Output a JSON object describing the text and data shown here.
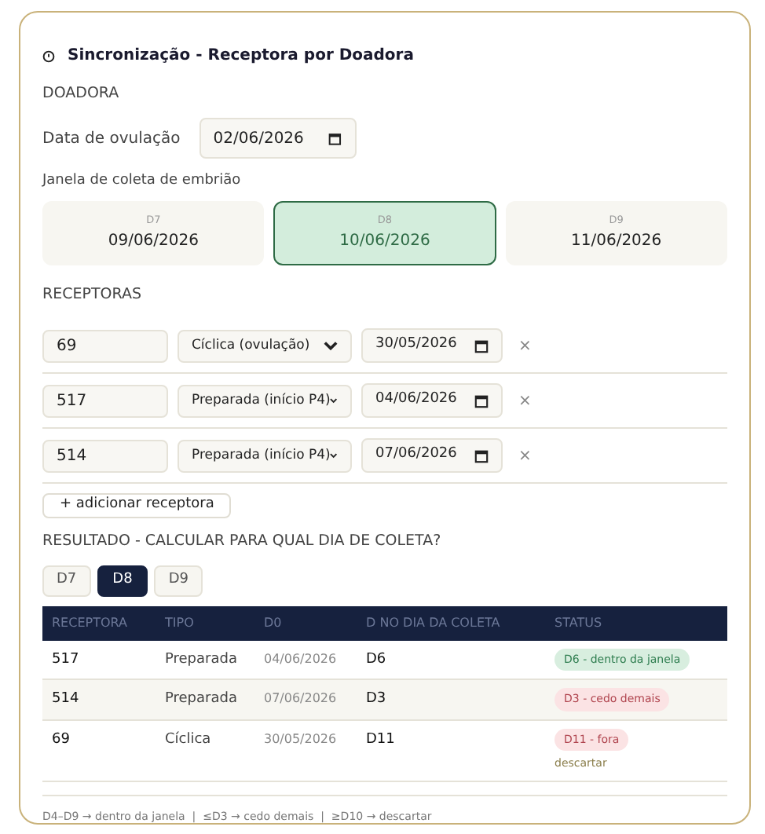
{
  "title": "Sincronização - Receptora por Doadora",
  "donor": {
    "heading": "DOADORA",
    "ovulation_label": "Data de ovulação",
    "ovulation_date": "02/06/2026"
  },
  "window": {
    "label": "Janela de coleta de embrião",
    "days": [
      {
        "day": "D7",
        "date": "09/06/2026",
        "selected": false
      },
      {
        "day": "D8",
        "date": "10/06/2026",
        "selected": true
      },
      {
        "day": "D9",
        "date": "11/06/2026",
        "selected": false
      }
    ]
  },
  "recipients": {
    "heading": "RECEPTORAS",
    "rows": [
      {
        "id": "69",
        "type": "Cíclica (ovulação)",
        "date": "30/05/2026",
        "remove": "×"
      },
      {
        "id": "517",
        "type": "Preparada (início P4)",
        "date": "04/06/2026",
        "remove": "×"
      },
      {
        "id": "514",
        "type": "Preparada (início P4)",
        "date": "07/06/2026",
        "remove": "×"
      }
    ],
    "add_button": "+ adicionar receptora"
  },
  "result": {
    "heading": "RESULTADO - CALCULAR PARA QUAL DIA DE COLETA?",
    "day_tabs": [
      {
        "label": "D7",
        "selected": false
      },
      {
        "label": "D8",
        "selected": true
      },
      {
        "label": "D9",
        "selected": false
      }
    ],
    "table": {
      "columns": [
        "RECEPTORA",
        "TIPO",
        "D0",
        "D NO DIA DA COLETA",
        "STATUS"
      ],
      "rows": [
        {
          "recipient": "517",
          "type": "Preparada",
          "d0": "04/06/2026",
          "day": "D6",
          "status": {
            "kind": "ok",
            "label": "D6 - dentro da janela"
          }
        },
        {
          "recipient": "514",
          "type": "Preparada",
          "d0": "07/06/2026",
          "day": "D3",
          "status": {
            "kind": "early",
            "label": "D3 - cedo demais"
          }
        },
        {
          "recipient": "69",
          "type": "Cíclica",
          "d0": "30/05/2026",
          "day": "D11",
          "status": {
            "kind": "out",
            "label": "D11 - fora",
            "note": "descartar"
          }
        }
      ]
    },
    "legend": "D4–D9 → dentro da janela  |  ≤D3 → cedo demais  |  ≥D10 → descartar"
  }
}
